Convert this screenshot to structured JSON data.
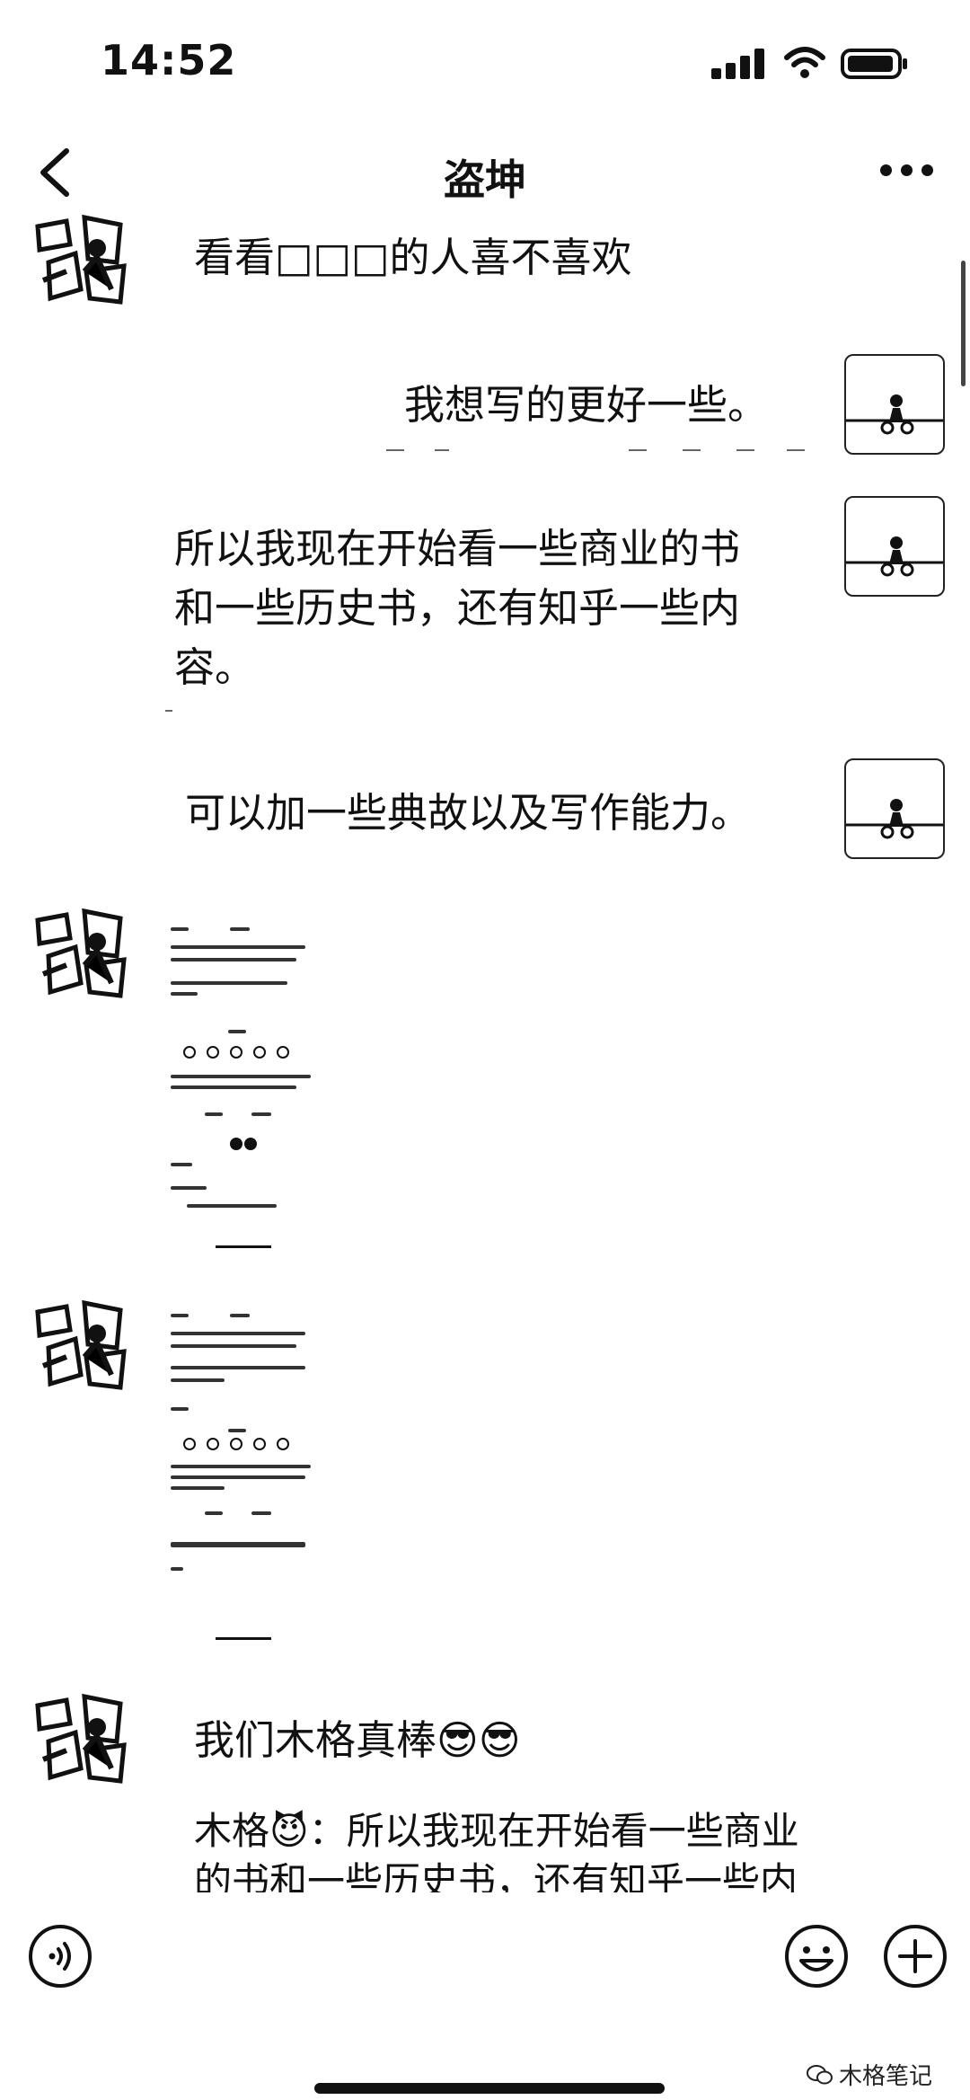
{
  "status_bar": {
    "time": "14:52"
  },
  "header": {
    "title": "盗坤"
  },
  "messages": [
    {
      "side": "left",
      "text": "看看□□□的人喜不喜欢"
    },
    {
      "side": "right",
      "text": "我想写的更好一些。"
    },
    {
      "side": "right",
      "line1": "所以我现在开始看一些商业的书",
      "line2": "和一些历史书，还有知乎一些内",
      "line3": "容。"
    },
    {
      "side": "right",
      "text": "可以加一些典故以及写作能力。"
    },
    {
      "side": "left",
      "text": "我们木格真棒😎😎"
    }
  ],
  "quote": {
    "line1": "木格😈：所以我现在开始看一些商业",
    "line2": "的书和一些历史书，还有知乎一些内"
  },
  "bottom_bar": {
    "voice": "voice-icon",
    "emoji": "emoji-icon",
    "plus": "plus-icon"
  },
  "watermark": "木格笔记"
}
